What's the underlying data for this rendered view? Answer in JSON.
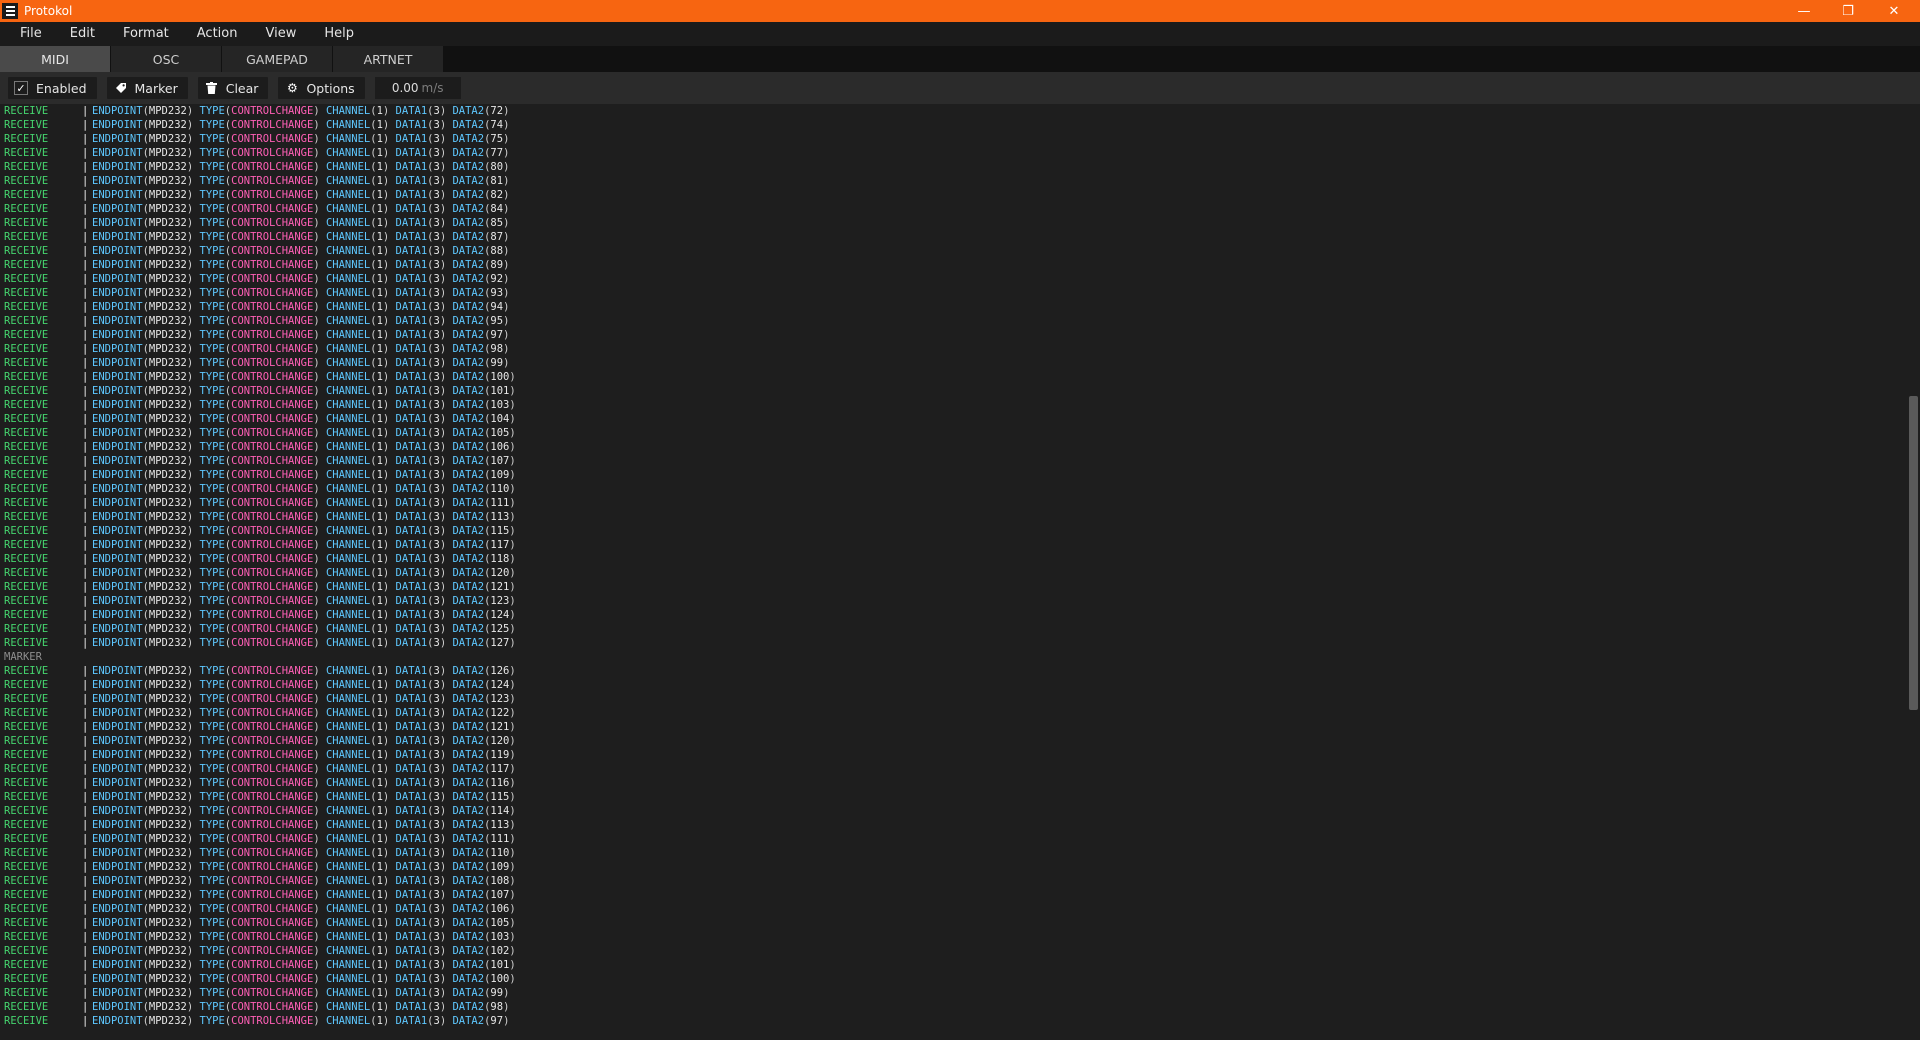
{
  "window": {
    "title": "Protokol",
    "minimize": "—",
    "maximize": "❐",
    "close": "✕"
  },
  "menu": [
    "File",
    "Edit",
    "Format",
    "Action",
    "View",
    "Help"
  ],
  "tabs": [
    {
      "label": "MIDI",
      "active": true
    },
    {
      "label": "OSC",
      "active": false
    },
    {
      "label": "GAMEPAD",
      "active": false
    },
    {
      "label": "ARTNET",
      "active": false
    }
  ],
  "toolbar": {
    "enabled_label": "Enabled",
    "enabled_checked": true,
    "marker_label": "Marker",
    "clear_label": "Clear",
    "options_label": "Options",
    "rate_value": "0.00",
    "rate_unit": "m/s"
  },
  "log_labels": {
    "receive": "RECEIVE",
    "separator": "|",
    "endpoint": "ENDPOINT",
    "type": "TYPE",
    "channel": "CHANNEL",
    "data1": "DATA1",
    "data2": "DATA2",
    "marker": "MARKER"
  },
  "log_defaults": {
    "endpoint": "MPD232",
    "type": "CONTROLCHANGE",
    "channel": "1",
    "data1": "3"
  },
  "log_rows": [
    {
      "kind": "receive",
      "data2": "72"
    },
    {
      "kind": "receive",
      "data2": "74"
    },
    {
      "kind": "receive",
      "data2": "75"
    },
    {
      "kind": "receive",
      "data2": "77"
    },
    {
      "kind": "receive",
      "data2": "80"
    },
    {
      "kind": "receive",
      "data2": "81"
    },
    {
      "kind": "receive",
      "data2": "82"
    },
    {
      "kind": "receive",
      "data2": "84"
    },
    {
      "kind": "receive",
      "data2": "85"
    },
    {
      "kind": "receive",
      "data2": "87"
    },
    {
      "kind": "receive",
      "data2": "88"
    },
    {
      "kind": "receive",
      "data2": "89"
    },
    {
      "kind": "receive",
      "data2": "92"
    },
    {
      "kind": "receive",
      "data2": "93"
    },
    {
      "kind": "receive",
      "data2": "94"
    },
    {
      "kind": "receive",
      "data2": "95"
    },
    {
      "kind": "receive",
      "data2": "97"
    },
    {
      "kind": "receive",
      "data2": "98"
    },
    {
      "kind": "receive",
      "data2": "99"
    },
    {
      "kind": "receive",
      "data2": "100"
    },
    {
      "kind": "receive",
      "data2": "101"
    },
    {
      "kind": "receive",
      "data2": "103"
    },
    {
      "kind": "receive",
      "data2": "104"
    },
    {
      "kind": "receive",
      "data2": "105"
    },
    {
      "kind": "receive",
      "data2": "106"
    },
    {
      "kind": "receive",
      "data2": "107"
    },
    {
      "kind": "receive",
      "data2": "109"
    },
    {
      "kind": "receive",
      "data2": "110"
    },
    {
      "kind": "receive",
      "data2": "111"
    },
    {
      "kind": "receive",
      "data2": "113"
    },
    {
      "kind": "receive",
      "data2": "115"
    },
    {
      "kind": "receive",
      "data2": "117"
    },
    {
      "kind": "receive",
      "data2": "118"
    },
    {
      "kind": "receive",
      "data2": "120"
    },
    {
      "kind": "receive",
      "data2": "121"
    },
    {
      "kind": "receive",
      "data2": "123"
    },
    {
      "kind": "receive",
      "data2": "124"
    },
    {
      "kind": "receive",
      "data2": "125"
    },
    {
      "kind": "receive",
      "data2": "127"
    },
    {
      "kind": "marker"
    },
    {
      "kind": "receive",
      "data2": "126"
    },
    {
      "kind": "receive",
      "data2": "124"
    },
    {
      "kind": "receive",
      "data2": "123"
    },
    {
      "kind": "receive",
      "data2": "122"
    },
    {
      "kind": "receive",
      "data2": "121"
    },
    {
      "kind": "receive",
      "data2": "120"
    },
    {
      "kind": "receive",
      "data2": "119"
    },
    {
      "kind": "receive",
      "data2": "117"
    },
    {
      "kind": "receive",
      "data2": "116"
    },
    {
      "kind": "receive",
      "data2": "115"
    },
    {
      "kind": "receive",
      "data2": "114"
    },
    {
      "kind": "receive",
      "data2": "113"
    },
    {
      "kind": "receive",
      "data2": "111"
    },
    {
      "kind": "receive",
      "data2": "110"
    },
    {
      "kind": "receive",
      "data2": "109"
    },
    {
      "kind": "receive",
      "data2": "108"
    },
    {
      "kind": "receive",
      "data2": "107"
    },
    {
      "kind": "receive",
      "data2": "106"
    },
    {
      "kind": "receive",
      "data2": "105"
    },
    {
      "kind": "receive",
      "data2": "103"
    },
    {
      "kind": "receive",
      "data2": "102"
    },
    {
      "kind": "receive",
      "data2": "101"
    },
    {
      "kind": "receive",
      "data2": "100"
    },
    {
      "kind": "receive",
      "data2": "99"
    },
    {
      "kind": "receive",
      "data2": "98"
    },
    {
      "kind": "receive",
      "data2": "97"
    }
  ],
  "colors": {
    "title_bar": "#f76511",
    "receive": "#45d46e",
    "label": "#5ec8ff",
    "type_value": "#ff5fb6",
    "marker": "#8e8e8e"
  }
}
